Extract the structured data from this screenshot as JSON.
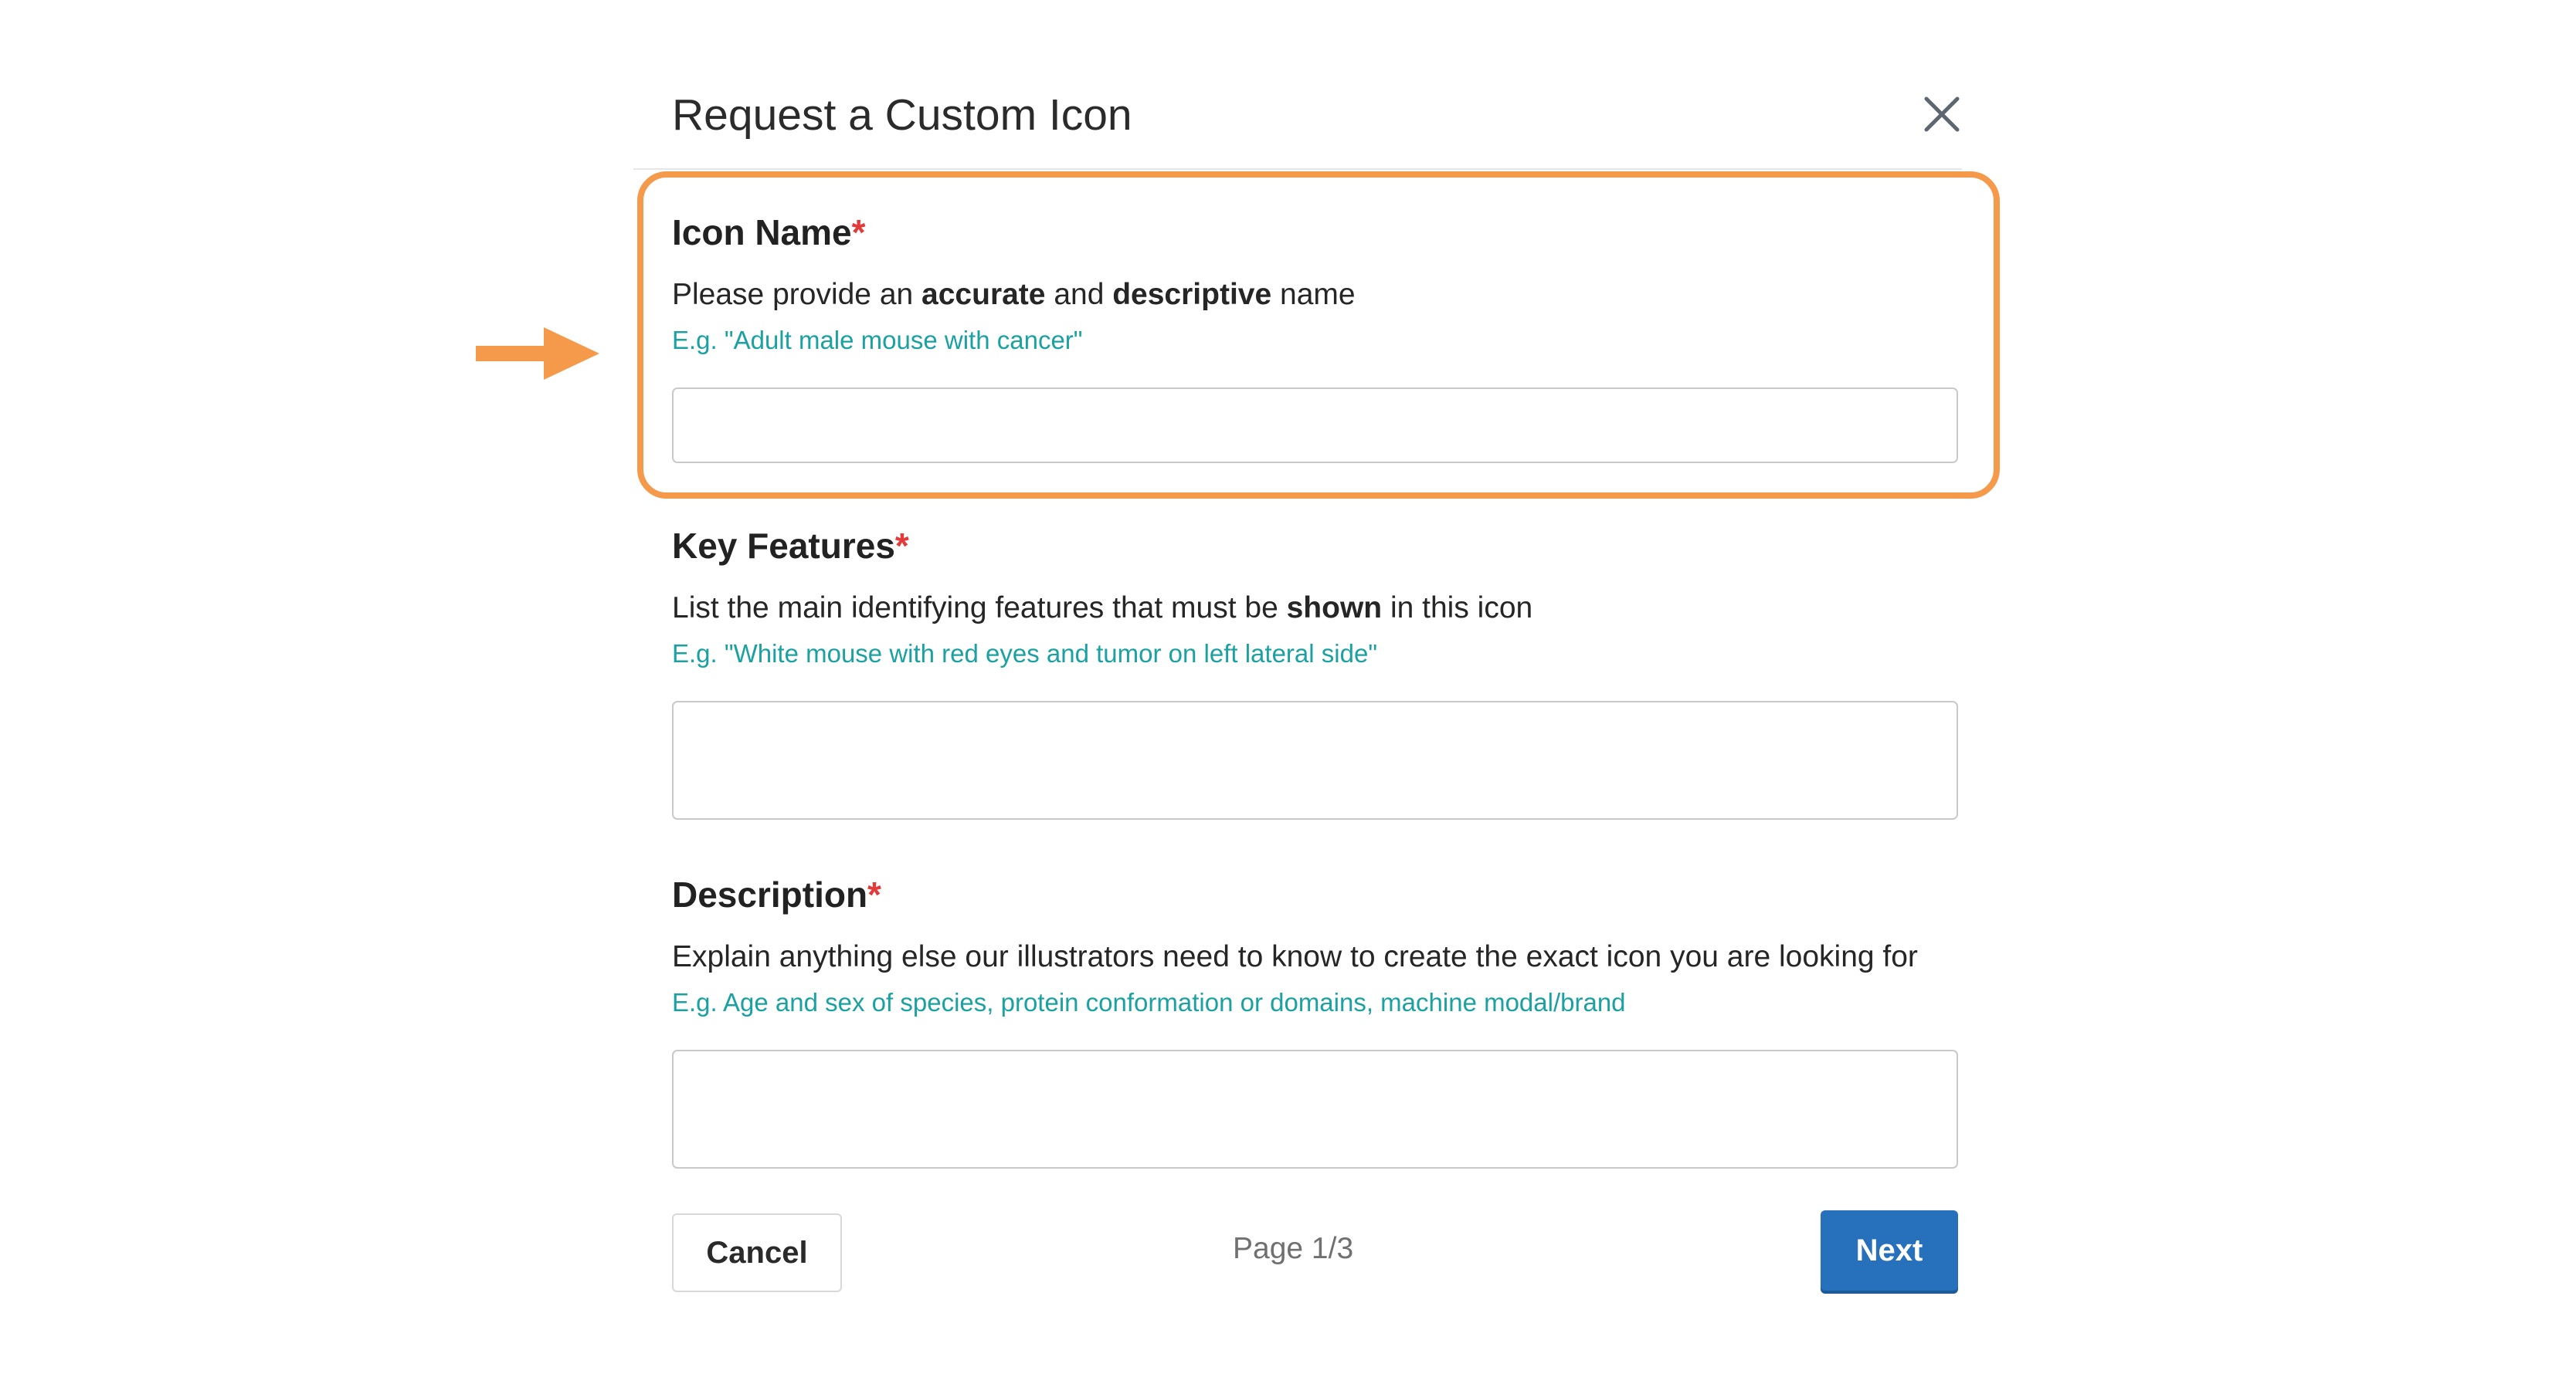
{
  "dialog": {
    "title": "Request a Custom Icon",
    "close_icon": "close-icon"
  },
  "fields": [
    {
      "label": "Icon Name",
      "required_mark": "*",
      "help_before": "Please provide an ",
      "help_bold_1": "accurate",
      "help_middle": " and ",
      "help_bold_2": "descriptive",
      "help_after": " name",
      "example": "E.g. \"Adult male mouse with cancer\"",
      "value": ""
    },
    {
      "label": "Key Features",
      "required_mark": "*",
      "help_before": "List the main identifying features that must be ",
      "help_bold_1": "shown",
      "help_after": " in this icon",
      "example": "E.g. \"White mouse with red eyes and tumor on left lateral side\"",
      "value": ""
    },
    {
      "label": "Description",
      "required_mark": "*",
      "help_before": "Explain anything else our illustrators need to know to create the exact icon you are looking for",
      "example": "E.g. Age and sex of species, protein conformation or domains, machine modal/brand",
      "value": ""
    }
  ],
  "footer": {
    "cancel_label": "Cancel",
    "page_indicator": "Page 1/3",
    "next_label": "Next"
  },
  "annotation": {
    "highlight_color": "#f59a4b",
    "arrow_icon": "arrow-right-icon"
  },
  "colors": {
    "primary": "#2670bc",
    "example_text": "#1ba1a1",
    "required": "#e23a3a"
  }
}
